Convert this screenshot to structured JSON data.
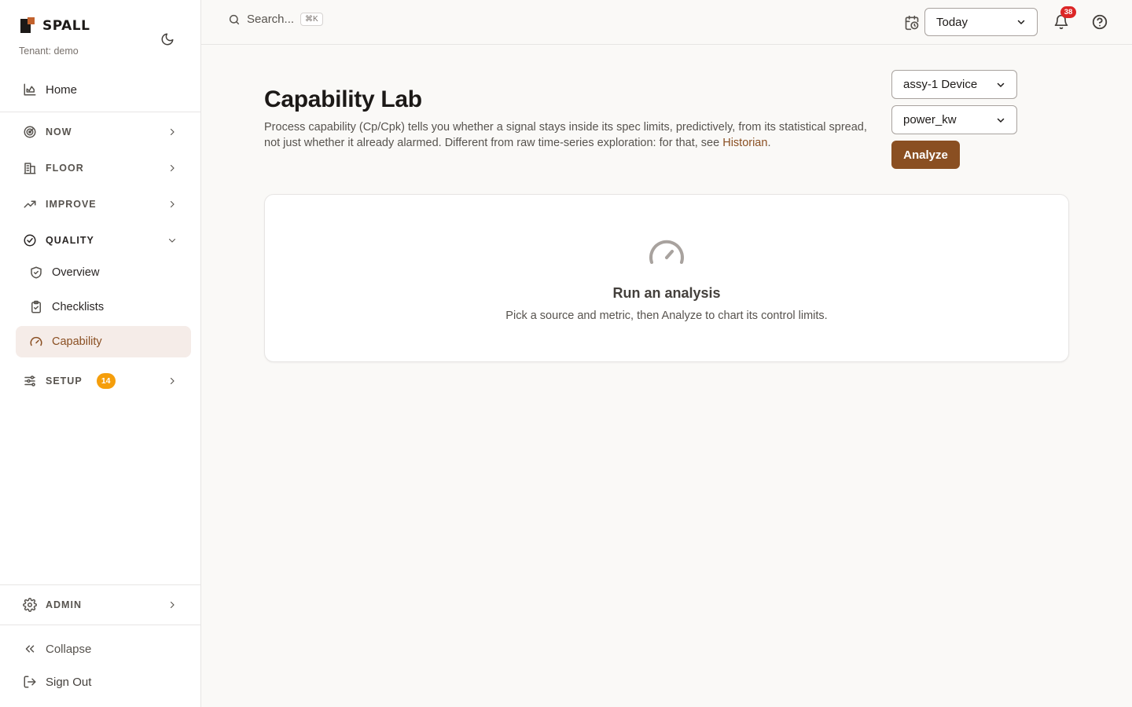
{
  "brand": {
    "name": "SPALL",
    "tenant": "Tenant: demo"
  },
  "sidebar": {
    "home": "Home",
    "sections": [
      {
        "label": "NOW"
      },
      {
        "label": "FLOOR"
      },
      {
        "label": "IMPROVE"
      },
      {
        "label": "QUALITY"
      },
      {
        "label": "SETUP",
        "badge": "14"
      }
    ],
    "quality_items": [
      {
        "label": "Overview"
      },
      {
        "label": "Checklists"
      },
      {
        "label": "Capability",
        "active": true
      }
    ],
    "admin": "ADMIN",
    "collapse": "Collapse",
    "sign_out": "Sign Out"
  },
  "topbar": {
    "search_placeholder": "Search...",
    "shortcut": "⌘K",
    "range": "Today",
    "notifications": "38"
  },
  "main": {
    "title": "Capability Lab",
    "description": "Process capability (Cp/Cpk) tells you whether a signal stays inside its spec limits, predictively, from its statistical spread, not just whether it already alarmed. Different from raw time-series exploration: for that, see ",
    "description_link": "Historian",
    "description_end": ".",
    "source_select": "assy-1 Device",
    "metric_select": "power_kw",
    "analyze_label": "Analyze",
    "empty_title": "Run an analysis",
    "empty_subtitle": "Pick a source and metric, then Analyze to chart its control limits."
  },
  "colors": {
    "accent": "#8a4f22",
    "active_bg": "#f5ece8",
    "badge": "#f59e0b",
    "notif": "#dc2626"
  }
}
